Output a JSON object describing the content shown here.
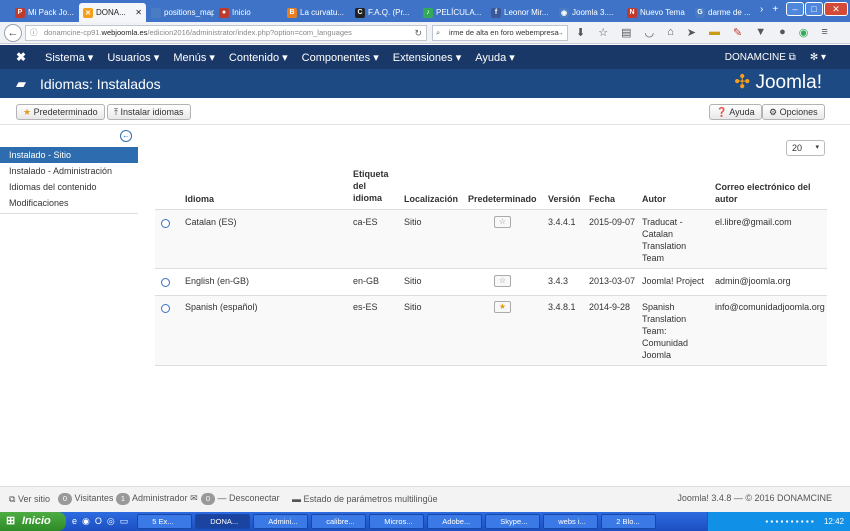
{
  "browser": {
    "tabs": [
      {
        "label": "Mi Pack Jo...",
        "color": "#c0392b",
        "glyph": "P"
      },
      {
        "label": "DONA...",
        "color": "#f4a01b",
        "glyph": "✕",
        "active": true
      },
      {
        "label": "positions_map...",
        "color": "#4a7cc4",
        "glyph": ""
      },
      {
        "label": "Inicio",
        "color": "#c0392b",
        "glyph": "●"
      },
      {
        "label": "La curvatu...",
        "color": "#e67e22",
        "glyph": "B"
      },
      {
        "label": "F.A.Q. (Pr...",
        "color": "#222",
        "glyph": "C"
      },
      {
        "label": "PELÍCULA...",
        "color": "#3a5",
        "glyph": "♪"
      },
      {
        "label": "Leonor Mir...",
        "color": "#3b5998",
        "glyph": "f"
      },
      {
        "label": "Joomla 3....",
        "color": "#4a7cc4",
        "glyph": "◉"
      },
      {
        "label": "Nuevo Tema",
        "color": "#c0392b",
        "glyph": "N"
      },
      {
        "label": "darme de ...",
        "color": "#4a7cc4",
        "glyph": "G"
      }
    ],
    "url_prefix": "donamcine-cp91.",
    "url_domain": "webjoomla.es",
    "url_path": "/edicion2016/administrator/index.php?option=com_languages",
    "search_value": "irme de alta en foro webempresa"
  },
  "navbar": {
    "menus": [
      "Sistema",
      "Usuarios",
      "Menús",
      "Contenido",
      "Componentes",
      "Extensiones",
      "Ayuda"
    ],
    "site_name": "DONAMCINE",
    "logo_text": "Joomla!"
  },
  "header": {
    "title": "Idiomas: Instalados"
  },
  "toolbar": {
    "default_label": "Predeterminado",
    "install_label": "Instalar idiomas",
    "help_label": "Ayuda",
    "options_label": "Opciones"
  },
  "sidebar": {
    "items": [
      "Instalado - Sitio",
      "Instalado - Administración",
      "Idiomas del contenido",
      "Modificaciones"
    ]
  },
  "list_limit": "20",
  "table": {
    "headers": {
      "language": "Idioma",
      "tag": "Etiqueta del idioma",
      "location": "Localización",
      "default": "Predeterminado",
      "version": "Versión",
      "date": "Fecha",
      "author": "Autor",
      "email": "Correo electrónico del autor"
    },
    "rows": [
      {
        "language": "Catalan (ES)",
        "tag": "ca-ES",
        "location": "Sitio",
        "default": false,
        "version": "3.4.4.1",
        "date": "2015-09-07",
        "author": "Traducat - Catalan Translation Team",
        "email": "el.libre@gmail.com"
      },
      {
        "language": "English (en-GB)",
        "tag": "en-GB",
        "location": "Sitio",
        "default": false,
        "version": "3.4.3",
        "date": "2013-03-07",
        "author": "Joomla! Project",
        "email": "admin@joomla.org"
      },
      {
        "language": "Spanish (español)",
        "tag": "es-ES",
        "location": "Sitio",
        "default": true,
        "version": "3.4.8.1",
        "date": "2014-9-28",
        "author": "Spanish Translation Team: Comunidad Joomla",
        "email": "info@comunidadjoomla.org"
      }
    ]
  },
  "footer": {
    "view_site": "Ver sitio",
    "visitors_count": "0",
    "visitors": "Visitantes",
    "admins_count": "1",
    "admins": "Administrador",
    "logout_count": "0",
    "logout": "Desconectar",
    "multilang": "Estado de parámetros multilingüe",
    "version": "Joomla! 3.4.8 — © 2016 DONAMCINE"
  },
  "taskbar": {
    "start": "Inicio",
    "items": [
      "5 Ex...",
      "DONA...",
      "Admini...",
      "calibre...",
      "Micros...",
      "Adobe...",
      "Skype...",
      "webs i...",
      "2 Blo..."
    ],
    "clock": "12:42"
  }
}
